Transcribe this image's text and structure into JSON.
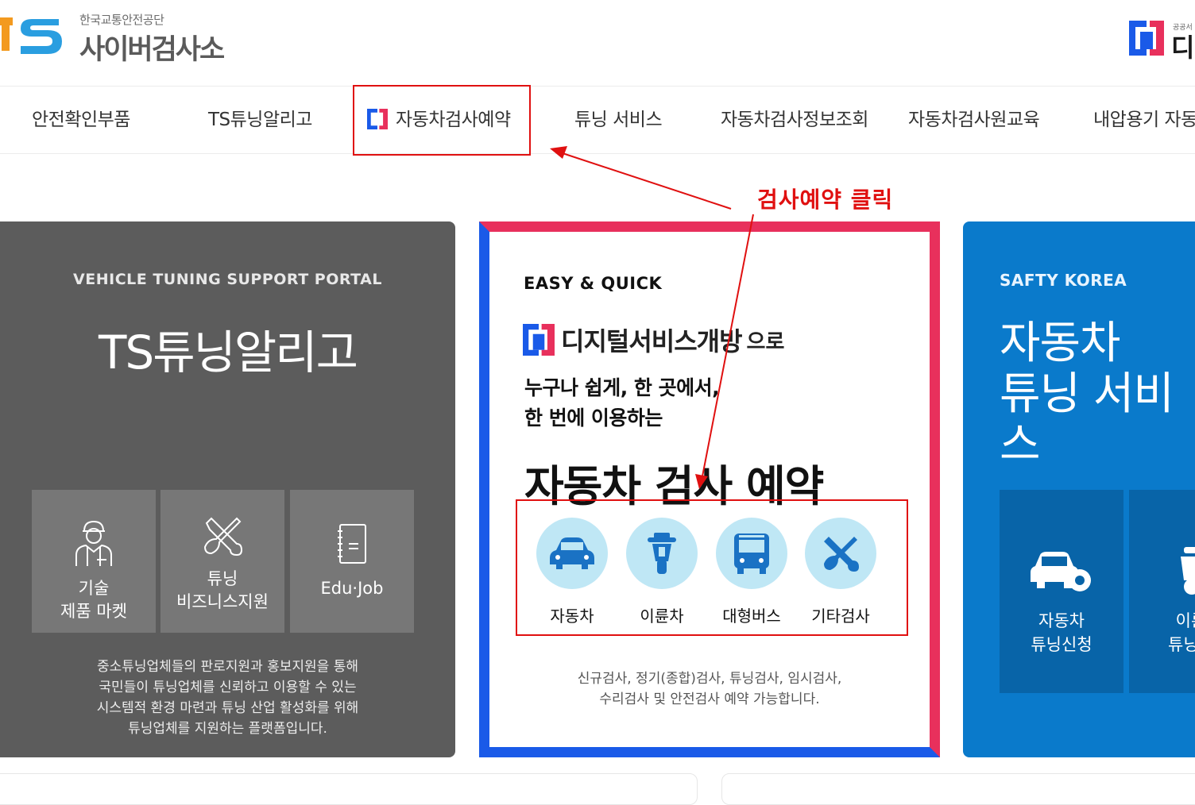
{
  "header": {
    "org_name": "한국교통안전공단",
    "site_name": "사이버검사소",
    "logo_text": "TS",
    "right_small": "공공서",
    "right_text": "디지"
  },
  "nav": {
    "items": [
      {
        "label": "안전확인부품"
      },
      {
        "label": "TS튜닝알리고"
      },
      {
        "label": "자동차검사예약"
      },
      {
        "label": "튜닝 서비스"
      },
      {
        "label": "자동차검사정보조회"
      },
      {
        "label": "자동차검사원교육"
      },
      {
        "label": "내압용기 자동"
      }
    ]
  },
  "tuning_card": {
    "subtitle": "VEHICLE TUNING SUPPORT PORTAL",
    "title": "TS튜닝알리고",
    "tiles": [
      {
        "label": "기술\n제품 마켓",
        "icon": "mechanic-icon"
      },
      {
        "label": "튜닝\n비즈니스지원",
        "icon": "tools-icon"
      },
      {
        "label": "Edu·Job",
        "icon": "notebook-icon"
      }
    ],
    "description": "중소튜닝업체들의 판로지원과 홍보지원을 통해\n국민들이 튜닝업체를 신뢰하고 이용할 수 있는\n시스템적 환경 마련과 튜닝 산업 활성화를 위해\n튜닝업체를 지원하는 플랫폼입니다."
  },
  "booking_card": {
    "tag": "EASY & QUICK",
    "digital_text": "디지털서비스개방",
    "digital_suffix": "으로",
    "lead": "누구나 쉽게, 한 곳에서,\n한 번에 이용하는",
    "title": "자동차 검사 예약",
    "vehicles": [
      {
        "label": "자동차",
        "icon": "car-icon"
      },
      {
        "label": "이륜차",
        "icon": "motorcycle-icon"
      },
      {
        "label": "대형버스",
        "icon": "bus-icon"
      },
      {
        "label": "기타검사",
        "icon": "wrench-icon"
      }
    ],
    "description": "신규검사, 정기(종합)검사, 튜닝검사, 임시검사,\n수리검사 및 안전검사 예약 가능합니다."
  },
  "service_card": {
    "subtitle": "SAFTY KOREA",
    "title": "자동차\n튜닝 서비스",
    "tiles": [
      {
        "label": "자동차\n튜닝신청",
        "icon": "car-gear-icon"
      },
      {
        "label": "이륜\n튜닝신",
        "icon": "scooter-icon"
      }
    ]
  },
  "annotation": {
    "label": "검사예약 클릭",
    "color": "#e01010"
  },
  "colors": {
    "accent_red": "#e8305c",
    "accent_blue": "#1a5ae8",
    "gray_card": "#5c5c5c",
    "blue_card": "#0a7acb",
    "vehicle_circle": "#bfe7f5"
  }
}
